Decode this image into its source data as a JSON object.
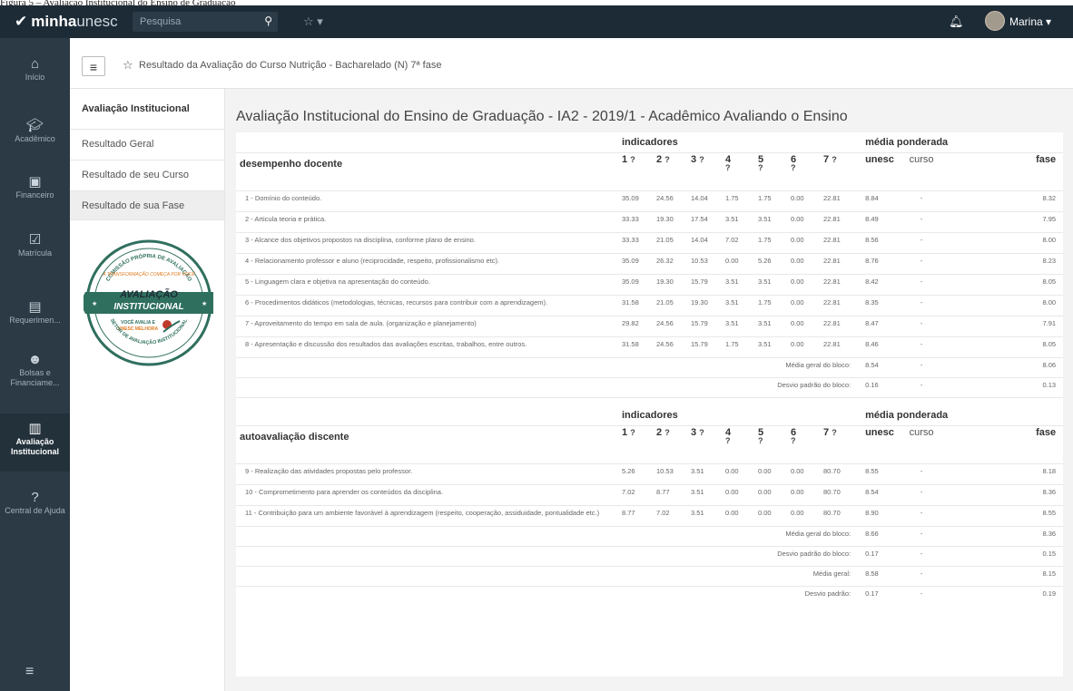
{
  "caption": "Figura 5 – Avaliação Institucional do Ensino de Graduação",
  "topbar": {
    "brand_bold": "minha",
    "brand_thin": "unesc",
    "search_placeholder": "Pesquisa",
    "user_name": "Marina"
  },
  "nav": {
    "items": [
      {
        "label": "Início"
      },
      {
        "label": "Acadêmico"
      },
      {
        "label": "Financeiro"
      },
      {
        "label": "Matrícula"
      },
      {
        "label": "Requerimen..."
      },
      {
        "label": "Bolsas e Financiame..."
      },
      {
        "label": "Avaliação Institucional"
      },
      {
        "label": "Central de Ajuda"
      }
    ]
  },
  "breadcrumb": "Resultado da Avaliação do Curso Nutrição - Bacharelado (N) 7ª fase",
  "subnav": {
    "heading": "Avaliação Institucional",
    "items": [
      "Resultado Geral",
      "Resultado de seu Curso",
      "Resultado de sua Fase"
    ],
    "seal": {
      "arc_top": "COMISSÃO PRÓPRIA DE AVALIAÇÃO",
      "banner": "A TRANSFORMAÇÃO COMEÇA POR VOCÊ",
      "title1": "AVALIAÇÃO",
      "title2": "INSTITUCIONAL",
      "tag1": "VOCÊ AVALIA E",
      "tag2": "UNESC MELHORA",
      "arc_bottom": "SETOR DE AVALIAÇÃO INSTITUCIONAL"
    }
  },
  "page_title": "Avaliação Institucional do Ensino de Graduação - IA2 - 2019/1 - Acadêmico Avaliando o Ensino",
  "table": {
    "indicators_label": "indicadores",
    "weighted_label": "média ponderada",
    "cols": [
      "1",
      "2",
      "3",
      "4",
      "5",
      "6",
      "7"
    ],
    "weighted_cols": [
      "unesc",
      "curso",
      "fase"
    ],
    "help_glyph": "?",
    "blocks": [
      {
        "title": "desempenho docente",
        "rows": [
          {
            "label": "1 - Domínio do conteúdo.",
            "v": [
              "35.09",
              "24.56",
              "14.04",
              "1.75",
              "1.75",
              "0.00",
              "22.81"
            ],
            "w": [
              "8.84",
              "-",
              "8.32"
            ]
          },
          {
            "label": "2 - Articula teoria e prática.",
            "v": [
              "33.33",
              "19.30",
              "17.54",
              "3.51",
              "3.51",
              "0.00",
              "22.81"
            ],
            "w": [
              "8.49",
              "-",
              "7.95"
            ]
          },
          {
            "label": "3 - Alcance dos objetivos propostos na disciplina, conforme plano de ensino.",
            "v": [
              "33.33",
              "21.05",
              "14.04",
              "7.02",
              "1.75",
              "0.00",
              "22.81"
            ],
            "w": [
              "8.56",
              "-",
              "8.00"
            ]
          },
          {
            "label": "4 - Relacionamento professor e aluno (reciprocidade, respeito, profissionalismo etc).",
            "v": [
              "35.09",
              "26.32",
              "10.53",
              "0.00",
              "5.26",
              "0.00",
              "22.81"
            ],
            "w": [
              "8.76",
              "-",
              "8.23"
            ]
          },
          {
            "label": "5 - Linguagem clara e objetiva na apresentação do conteúdo.",
            "v": [
              "35.09",
              "19.30",
              "15.79",
              "3.51",
              "3.51",
              "0.00",
              "22.81"
            ],
            "w": [
              "8.42",
              "-",
              "8.05"
            ]
          },
          {
            "label": "6 - Procedimentos didáticos (metodologias, técnicas, recursos para contribuir com a aprendizagem).",
            "v": [
              "31.58",
              "21.05",
              "19.30",
              "3.51",
              "1.75",
              "0.00",
              "22.81"
            ],
            "w": [
              "8.35",
              "-",
              "8.00"
            ]
          },
          {
            "label": "7 - Aproveitamento do tempo em sala de aula. (organização e planejamento)",
            "v": [
              "29.82",
              "24.56",
              "15.79",
              "3.51",
              "3.51",
              "0.00",
              "22.81"
            ],
            "w": [
              "8.47",
              "-",
              "7.91"
            ]
          },
          {
            "label": "8 - Apresentação e discussão dos resultados das avaliações escritas, trabalhos, entre outros.",
            "v": [
              "31.58",
              "24.56",
              "15.79",
              "1.75",
              "3.51",
              "0.00",
              "22.81"
            ],
            "w": [
              "8.46",
              "-",
              "8.05"
            ]
          }
        ],
        "summary": [
          {
            "label": "Média geral do bloco:",
            "w": [
              "8.54",
              "-",
              "8.06"
            ]
          },
          {
            "label": "Desvio padrão do bloco:",
            "w": [
              "0.16",
              "-",
              "0.13"
            ]
          }
        ]
      },
      {
        "title": "autoavaliação discente",
        "rows": [
          {
            "label": "9 - Realização das atividades propostas pelo professor.",
            "v": [
              "5.26",
              "10.53",
              "3.51",
              "0.00",
              "0.00",
              "0.00",
              "80.70"
            ],
            "w": [
              "8.55",
              "-",
              "8.18"
            ]
          },
          {
            "label": "10 - Comprometimento para aprender os conteúdos da disciplina.",
            "v": [
              "7.02",
              "8.77",
              "3.51",
              "0.00",
              "0.00",
              "0.00",
              "80.70"
            ],
            "w": [
              "8.54",
              "-",
              "8.36"
            ]
          },
          {
            "label": "11 - Contribuição para um ambiente favorável à aprendizagem (respeito, cooperação, assiduidade, pontualidade etc.)",
            "v": [
              "8.77",
              "7.02",
              "3.51",
              "0.00",
              "0.00",
              "0.00",
              "80.70"
            ],
            "w": [
              "8.90",
              "-",
              "8.55"
            ]
          }
        ],
        "summary": [
          {
            "label": "Média geral do bloco:",
            "w": [
              "8.66",
              "-",
              "8.36"
            ]
          },
          {
            "label": "Desvio padrão do bloco:",
            "w": [
              "0.17",
              "-",
              "0.15"
            ]
          },
          {
            "label": "Média geral:",
            "w": [
              "8.58",
              "-",
              "8.15"
            ]
          },
          {
            "label": "Desvio padrão:",
            "w": [
              "0.17",
              "-",
              "0.19"
            ]
          }
        ]
      }
    ]
  },
  "colors": {
    "topbar": "#1d2b36",
    "sidebar": "#2c3a45",
    "seal_green": "#2f6f5e",
    "seal_orange": "#e07a1f"
  }
}
